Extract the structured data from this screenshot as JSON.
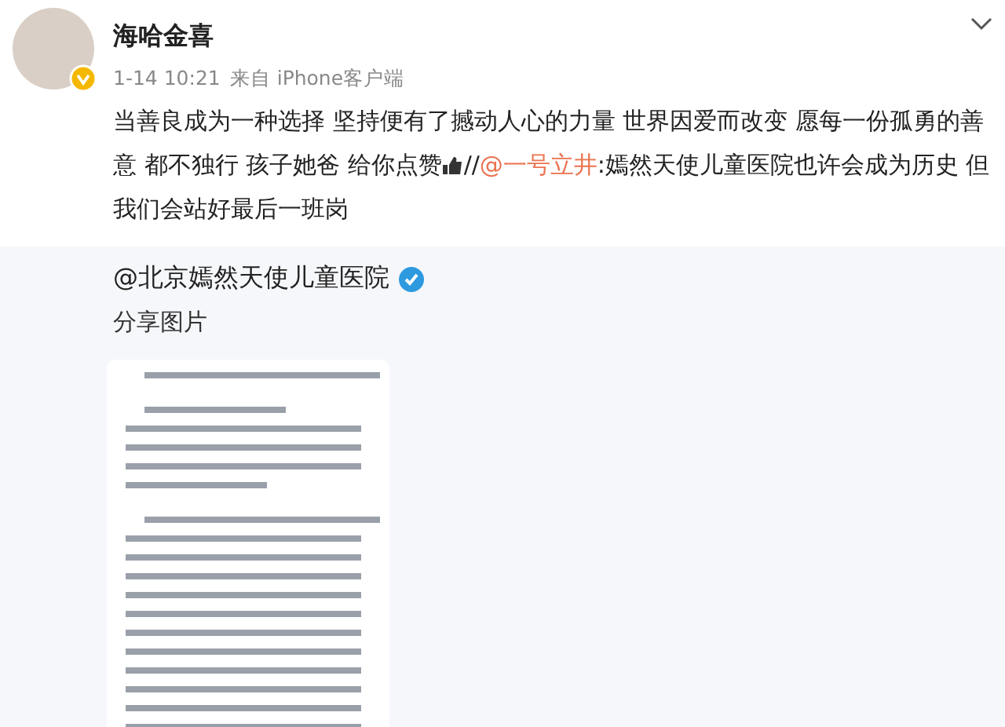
{
  "post": {
    "author": "海哈金喜",
    "verified": true,
    "time": "1-14 10:21",
    "source": "来自 iPhone客户端",
    "text_before_icon": "当善良成为一种选择 坚持便有了撼动人心的力量 世界因爱而改变 愿每一份孤勇的善意 都不独行 孩子她爸 给你点赞",
    "separator": "//",
    "mention": "@一号立井",
    "text_after_mention": ":嫣然天使儿童医院也许会成为历史 但我们会站好最后一班岗"
  },
  "repost": {
    "author": "@北京嫣然天使儿童医院",
    "verified": true,
    "text": "分享图片"
  }
}
